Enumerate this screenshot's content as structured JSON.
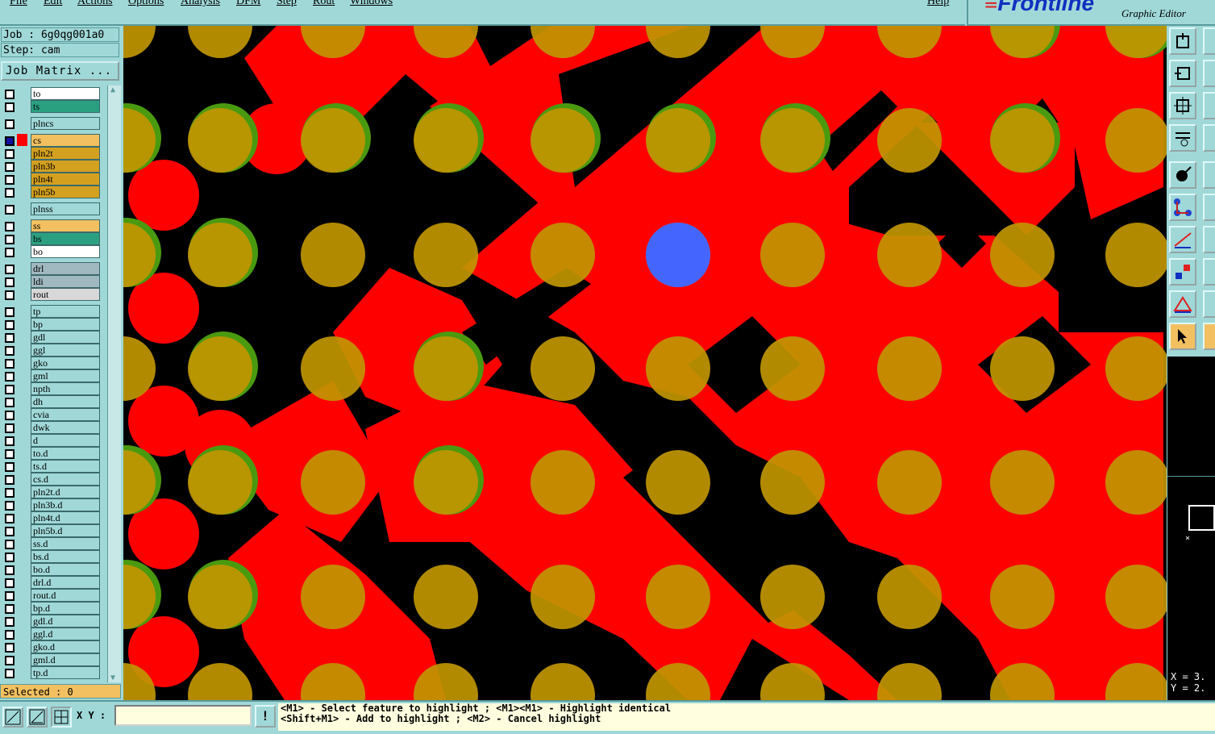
{
  "menu": {
    "items": [
      "File",
      "Edit",
      "Actions",
      "Options",
      "Analysis",
      "DFM",
      "Step",
      "Rout",
      "Windows"
    ],
    "help": "Help"
  },
  "brand": {
    "logo": "Frontline",
    "subtitle": "Graphic Editor"
  },
  "job": {
    "job_line": "Job : 6g0qg001a0",
    "step_line": "Step: cam",
    "matrix_button": "Job Matrix ..."
  },
  "layers": [
    {
      "name": "to",
      "color": "#ffffff",
      "swatch": "#a0d8d8"
    },
    {
      "name": "ts",
      "color": "#2aa080",
      "swatch": "#a0d8d8"
    },
    {
      "name": "plncs",
      "color": "#a0d8d8",
      "swatch": "#a0d8d8"
    },
    {
      "name": "cs",
      "color": "#f2c060",
      "swatch": "#ff0000",
      "active": true
    },
    {
      "name": "pln2t",
      "color": "#d4a020",
      "swatch": "#a0d8d8"
    },
    {
      "name": "pln3b",
      "color": "#d4a020",
      "swatch": "#a0d8d8"
    },
    {
      "name": "pln4t",
      "color": "#d4a020",
      "swatch": "#a0d8d8"
    },
    {
      "name": "pln5b",
      "color": "#d4a020",
      "swatch": "#a0d8d8"
    },
    {
      "name": "plnss",
      "color": "#a0d8d8",
      "swatch": "#a0d8d8"
    },
    {
      "name": "ss",
      "color": "#f2c060",
      "swatch": "#a0d8d8"
    },
    {
      "name": "bs",
      "color": "#2aa080",
      "swatch": "#a0d8d8"
    },
    {
      "name": "bo",
      "color": "#ffffff",
      "swatch": "#a0d8d8"
    },
    {
      "name": "drl",
      "color": "#a0b8c0",
      "swatch": "#a0d8d8"
    },
    {
      "name": "ldi",
      "color": "#a0b8c0",
      "swatch": "#a0d8d8"
    },
    {
      "name": "rout",
      "color": "#d8d8d8",
      "swatch": "#a0d8d8"
    },
    {
      "name": "tp",
      "color": "#a0d8d8",
      "swatch": "#a0d8d8"
    },
    {
      "name": "bp",
      "color": "#a0d8d8",
      "swatch": "#a0d8d8"
    },
    {
      "name": "gdl",
      "color": "#a0d8d8",
      "swatch": "#a0d8d8"
    },
    {
      "name": "ggl",
      "color": "#a0d8d8",
      "swatch": "#a0d8d8"
    },
    {
      "name": "gko",
      "color": "#a0d8d8",
      "swatch": "#a0d8d8"
    },
    {
      "name": "gml",
      "color": "#a0d8d8",
      "swatch": "#a0d8d8"
    },
    {
      "name": "npth",
      "color": "#a0d8d8",
      "swatch": "#a0d8d8"
    },
    {
      "name": "dh",
      "color": "#a0d8d8",
      "swatch": "#a0d8d8"
    },
    {
      "name": "cvia",
      "color": "#a0d8d8",
      "swatch": "#a0d8d8"
    },
    {
      "name": "dwk",
      "color": "#a0d8d8",
      "swatch": "#a0d8d8"
    },
    {
      "name": "d",
      "color": "#a0d8d8",
      "swatch": "#a0d8d8"
    },
    {
      "name": "to.d",
      "color": "#a0d8d8",
      "swatch": "#a0d8d8"
    },
    {
      "name": "ts.d",
      "color": "#a0d8d8",
      "swatch": "#a0d8d8"
    },
    {
      "name": "cs.d",
      "color": "#a0d8d8",
      "swatch": "#a0d8d8"
    },
    {
      "name": "pln2t.d",
      "color": "#a0d8d8",
      "swatch": "#a0d8d8"
    },
    {
      "name": "pln3b.d",
      "color": "#a0d8d8",
      "swatch": "#a0d8d8"
    },
    {
      "name": "pln4t.d",
      "color": "#a0d8d8",
      "swatch": "#a0d8d8"
    },
    {
      "name": "pln5b.d",
      "color": "#a0d8d8",
      "swatch": "#a0d8d8"
    },
    {
      "name": "ss.d",
      "color": "#a0d8d8",
      "swatch": "#a0d8d8"
    },
    {
      "name": "bs.d",
      "color": "#a0d8d8",
      "swatch": "#a0d8d8"
    },
    {
      "name": "bo.d",
      "color": "#a0d8d8",
      "swatch": "#a0d8d8"
    },
    {
      "name": "drl.d",
      "color": "#a0d8d8",
      "swatch": "#a0d8d8"
    },
    {
      "name": "rout.d",
      "color": "#a0d8d8",
      "swatch": "#a0d8d8"
    },
    {
      "name": "bp.d",
      "color": "#a0d8d8",
      "swatch": "#a0d8d8"
    },
    {
      "name": "gdl.d",
      "color": "#a0d8d8",
      "swatch": "#a0d8d8"
    },
    {
      "name": "ggl.d",
      "color": "#a0d8d8",
      "swatch": "#a0d8d8"
    },
    {
      "name": "gko.d",
      "color": "#a0d8d8",
      "swatch": "#a0d8d8"
    },
    {
      "name": "gml.d",
      "color": "#a0d8d8",
      "swatch": "#a0d8d8"
    },
    {
      "name": "tp.d",
      "color": "#a0d8d8",
      "swatch": "#a0d8d8"
    }
  ],
  "selected": "Selected : 0",
  "coords": {
    "x": "X = 3.",
    "y": "Y = 2."
  },
  "bottom": {
    "xy_label": "X Y :",
    "xy_value": "",
    "warn_icon": "!",
    "prompt_line1": "<M1> - Select feature to highlight ; <M1><M1> - Highlight identical",
    "prompt_line2": "<Shift+M1> - Add to highlight ; <M2> - Cancel highlight"
  },
  "colors": {
    "background": "#000000",
    "copper": "#ff0000",
    "pad": "#c09600",
    "pad_ring": "#4a9a10",
    "highlight": "#4466ff",
    "ui": "#a0d8d8"
  },
  "icons": {
    "toolbar": [
      "window-icon",
      "zoom-home-icon",
      "fit-icon",
      "tools-icon",
      "select-icon",
      "connect-icon",
      "measure-icon",
      "snap-icon",
      "triangle-icon",
      "pointer-icon"
    ]
  }
}
